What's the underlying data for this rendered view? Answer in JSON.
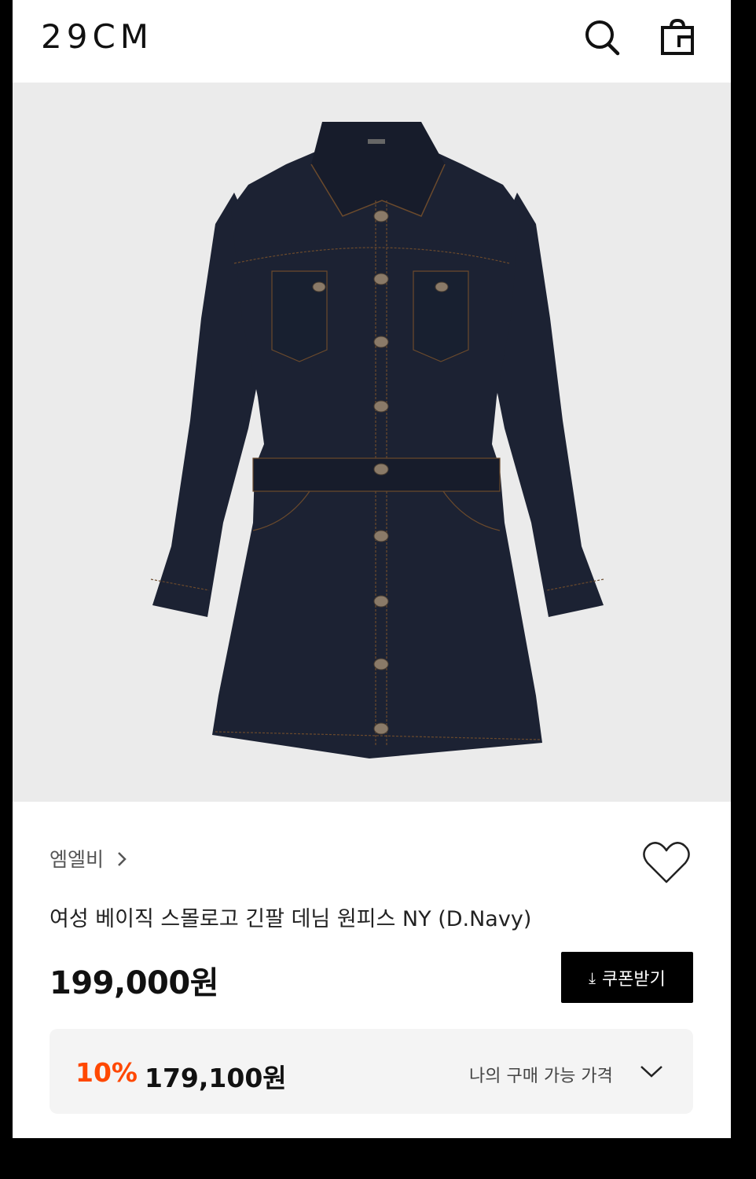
{
  "header": {
    "logo": "29CM",
    "search_icon": "search-icon",
    "bag_icon": "shopping-bag-icon"
  },
  "product": {
    "image_alt": "denim dress",
    "brand": "엠엘비",
    "title": "여성 베이직 스몰로고 긴팔 데님 원피스 NY (D.Navy)",
    "price": "199,000원",
    "coupon_button": "쿠폰받기",
    "discount_rate": "10%",
    "discount_price": "179,100원",
    "my_price_label": "나의 구매 가능 가격"
  },
  "colors": {
    "accent": "#ff4800",
    "background": "#ffffff",
    "image_bg": "#ebebeb",
    "denim": "#1c2233"
  }
}
